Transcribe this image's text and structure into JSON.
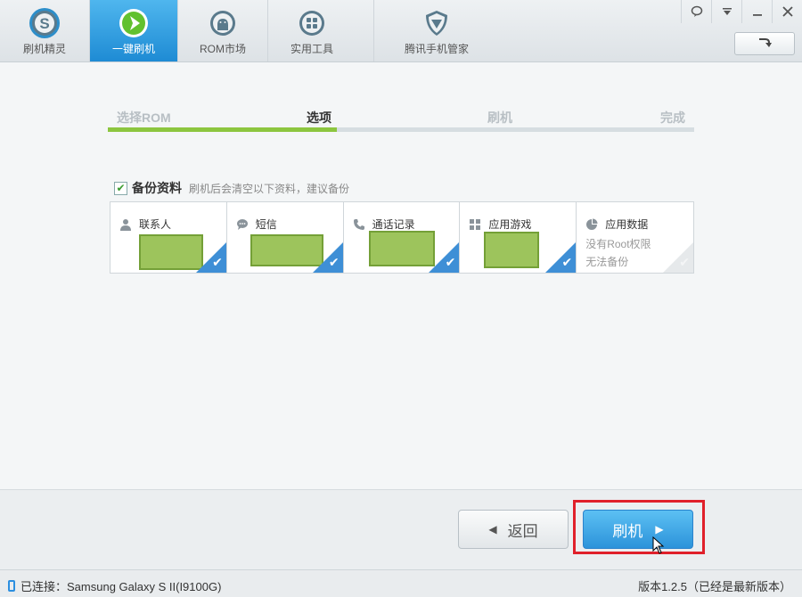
{
  "nav": {
    "items": [
      {
        "label": "刷机精灵",
        "icon": "shield-s-icon",
        "active": false
      },
      {
        "label": "一键刷机",
        "icon": "flash-arrow-icon",
        "active": true
      },
      {
        "label": "ROM市场",
        "icon": "android-icon",
        "active": false
      },
      {
        "label": "实用工具",
        "icon": "grid-tools-icon",
        "active": false
      },
      {
        "label": "腾讯手机管家",
        "icon": "tencent-shield-icon",
        "active": false
      }
    ],
    "colors": {
      "active_bg": "#2ea0e3",
      "toolbar_bg": "#e4e8eb"
    }
  },
  "window": {
    "buttons": [
      "feedback-icon",
      "dropdown-icon",
      "minimize-icon",
      "close-icon"
    ],
    "arrow_button_icon": "redo-arrow-icon"
  },
  "steps": {
    "items": [
      "选择ROM",
      "选项",
      "刷机",
      "完成"
    ],
    "active_index": 1,
    "progress_fraction": 0.39,
    "progress_color": "#8cc63f"
  },
  "backup": {
    "checked": true,
    "title": "备份资料",
    "note": "刷机后会清空以下资料，建议备份",
    "cards": [
      {
        "label": "联系人",
        "icon": "person-icon",
        "selected": true
      },
      {
        "label": "短信",
        "icon": "chat-bubble-icon",
        "selected": true
      },
      {
        "label": "通话记录",
        "icon": "phone-handset-icon",
        "selected": true
      },
      {
        "label": "应用游戏",
        "icon": "apps-grid-icon",
        "selected": true
      },
      {
        "label": "应用数据",
        "icon": "pie-chart-icon",
        "selected": false,
        "sub1": "没有Root权限",
        "sub2": "无法备份"
      }
    ],
    "selected_color": "#3e8fd6"
  },
  "actions": {
    "back_label": "返回",
    "flash_label": "刷机",
    "highlight_color": "#e0202a"
  },
  "status": {
    "connected": "已连接：Samsung Galaxy S II(I9100G)",
    "version": "版本1.2.5（已经是最新版本）"
  }
}
